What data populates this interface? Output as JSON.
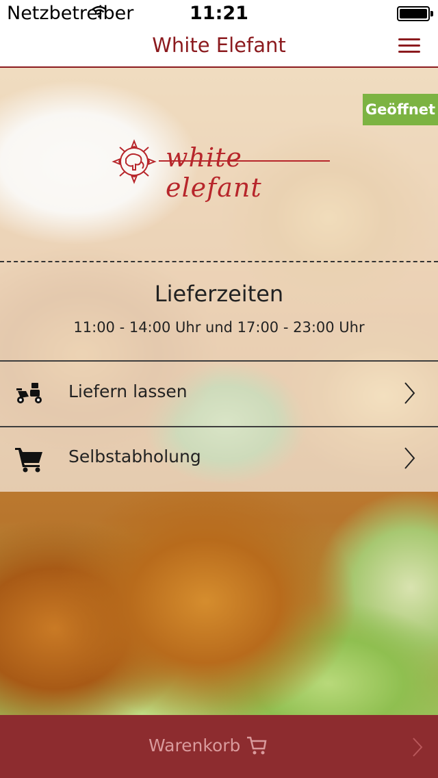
{
  "status_bar": {
    "carrier": "Netzbetreiber",
    "time": "11:21"
  },
  "nav": {
    "title": "White Elefant"
  },
  "badge": {
    "text": "Geöffnet"
  },
  "logo": {
    "text": "white elefant"
  },
  "delivery_times": {
    "title": "Lieferzeiten",
    "hours": "11:00 - 14:00 Uhr und 17:00 - 23:00 Uhr"
  },
  "options": [
    {
      "label": "Liefern lassen",
      "icon": "scooter-icon"
    },
    {
      "label": "Selbstabholung",
      "icon": "shopping-cart-icon"
    }
  ],
  "footer": {
    "label": "Warenkorb",
    "icon": "cart-icon"
  },
  "colors": {
    "brand": "#8b1a1e",
    "open_badge": "#7cb342",
    "footer": "#8d2c2f"
  }
}
